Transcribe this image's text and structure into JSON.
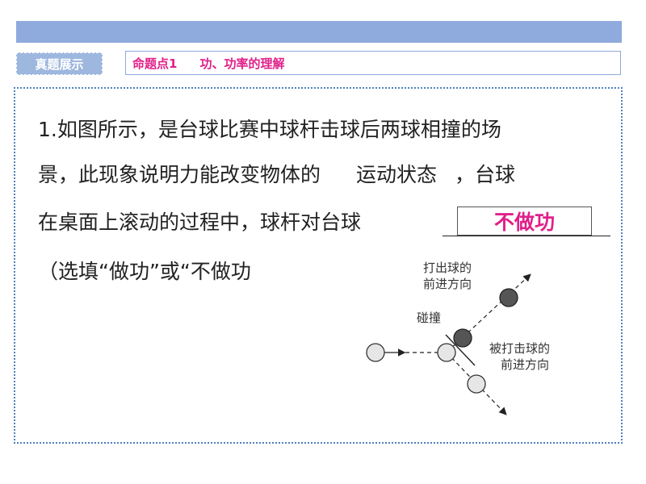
{
  "header": {
    "section_tag": "真题展示",
    "topic_label": "命题点1",
    "topic_title": "功、功率的理解"
  },
  "question": {
    "line1": "1.如图所示，是台球比赛中球杆击球后两球相撞的场",
    "line2_a": "景，此现象说明力能改变物体的",
    "line2_answer": "运动状态",
    "line2_b": "，台球",
    "line3": "在桌面上滚动的过程中，球杆对台球",
    "line3_answer": "不做功",
    "line4": "（选填“做功”或“不做功"
  },
  "diagram": {
    "label_struck_ball_1": "打出球的",
    "label_struck_ball_2": "前进方向",
    "label_collision": "碰撞",
    "label_hit_ball_1": "被打击球的",
    "label_hit_ball_2": "前进方向"
  },
  "colors": {
    "bar": "#8faadc",
    "accent": "#e0208a",
    "dotted_border": "#4f81bd"
  }
}
